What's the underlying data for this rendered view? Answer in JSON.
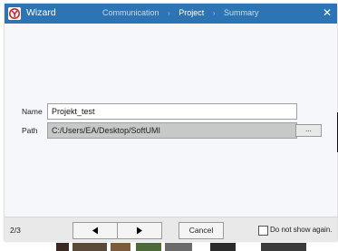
{
  "window": {
    "title": "Wizard",
    "close_symbol": "✕",
    "app_icon": "app-logo-icon",
    "accent_color": "#2c74b3"
  },
  "steps": [
    {
      "label": "Communication",
      "active": false
    },
    {
      "label": "Project",
      "active": true
    },
    {
      "label": "Summary",
      "active": false
    }
  ],
  "step_separator": "›",
  "form": {
    "name_label": "Name",
    "name_value": "Projekt_test",
    "path_label": "Path",
    "path_value": "C:/Users/EA/Desktop/SoftUMI",
    "browse_label": "..."
  },
  "footer": {
    "page_indicator": "2/3",
    "back_icon": "triangle-left-icon",
    "next_icon": "triangle-right-icon",
    "cancel_label": "Cancel",
    "dont_show_label": "Do not show again.",
    "dont_show_checked": false
  }
}
